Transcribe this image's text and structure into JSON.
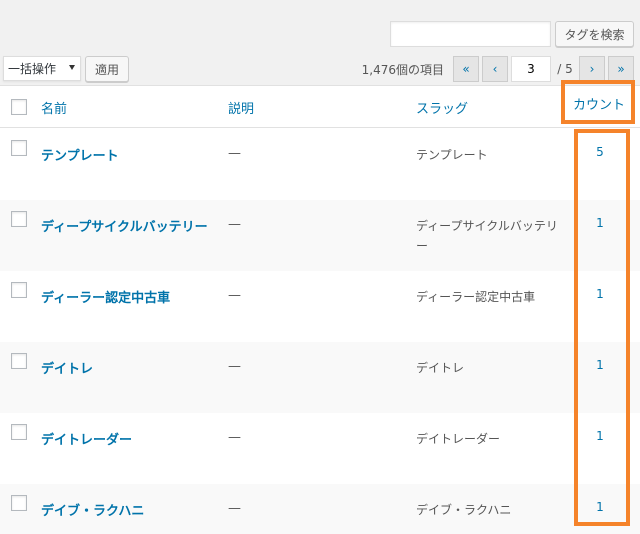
{
  "search": {
    "input_value": "",
    "button_label": "タグを検索"
  },
  "bulk": {
    "selected": "一括操作",
    "apply_label": "適用"
  },
  "pagination": {
    "items_count": "1,476個の項目",
    "first": "«",
    "prev": "‹",
    "current_page": "3",
    "total": "/ 5",
    "next": "›",
    "last": "»"
  },
  "columns": {
    "name": "名前",
    "description": "説明",
    "slug": "スラッグ",
    "count": "カウント"
  },
  "rows": [
    {
      "name": "テンプレート",
      "description": "—",
      "slug": "テンプレート",
      "count": "5"
    },
    {
      "name": "ディープサイクルバッテリー",
      "description": "—",
      "slug": "ディープサイクルバッテリー",
      "count": "1"
    },
    {
      "name": "ディーラー認定中古車",
      "description": "—",
      "slug": "ディーラー認定中古車",
      "count": "1"
    },
    {
      "name": "デイトレ",
      "description": "—",
      "slug": "デイトレ",
      "count": "1"
    },
    {
      "name": "デイトレーダー",
      "description": "—",
      "slug": "デイトレーダー",
      "count": "1"
    },
    {
      "name": "デイブ・ラクハニ",
      "description": "—",
      "slug": "デイブ・ラクハニ",
      "count": "1"
    }
  ],
  "colors": {
    "link": "#0073aa",
    "highlight": "#f5832a",
    "row_alt": "#f9f9f9"
  }
}
